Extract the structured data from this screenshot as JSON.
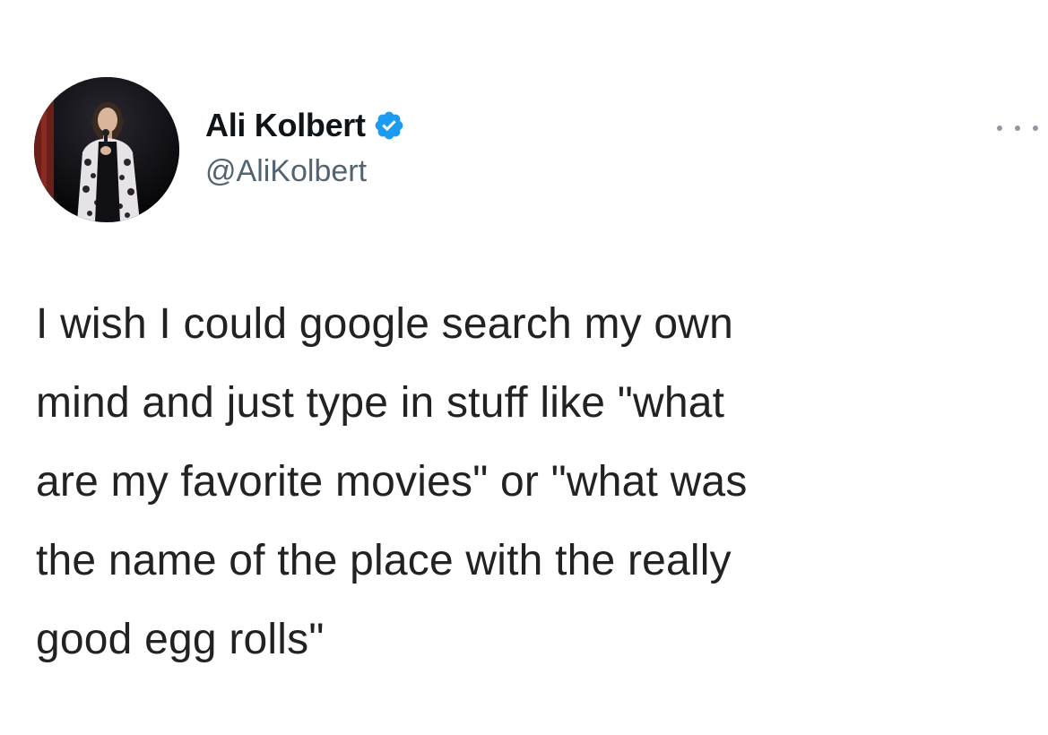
{
  "author": {
    "display_name": "Ali Kolbert",
    "handle": "@AliKolbert",
    "verified": true,
    "avatar_icon": "avatar-photo"
  },
  "menu": {
    "icon": "more-horizontal-icon"
  },
  "tweet": {
    "lines": [
      "I wish I could google search my own",
      "mind and just type in stuff like  \"what",
      "are my favorite movies\" or \"what was",
      "the name of the place with the really",
      "good egg rolls\""
    ]
  },
  "colors": {
    "verified_badge": "#1d9bf0",
    "handle_text": "#536471",
    "body_text": "#222222",
    "name_text": "#0f1419"
  }
}
